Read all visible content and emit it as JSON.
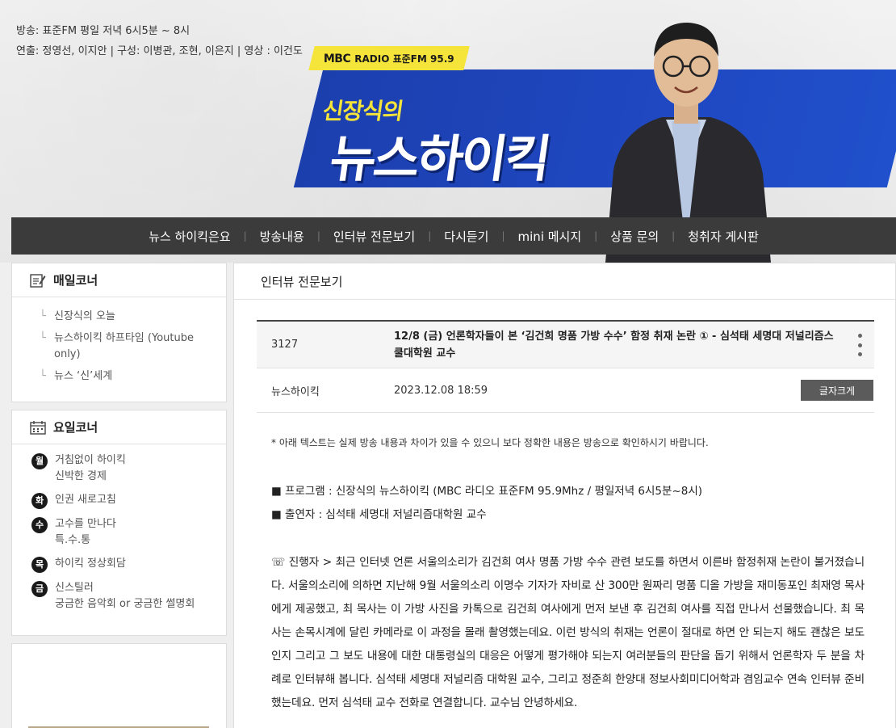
{
  "header": {
    "broadcast": "방송: 표준FM 평일 저녁 6시5분 ~ 8시",
    "staff": "연출: 정영선, 이지안 | 구성: 이병관, 조현, 이은지 | 영상 : 이건도",
    "logo_mbc": "MBC",
    "logo_radio": "RADIO 표준FM 95.9",
    "show_small": "신장식의",
    "show_big": "뉴스하이킥"
  },
  "nav": {
    "items": [
      "뉴스 하이킥은요",
      "방송내용",
      "인터뷰 전문보기",
      "다시듣기",
      "mini 메시지",
      "상품 문의",
      "청취자 게시판"
    ]
  },
  "sidebar": {
    "daily": {
      "title": "매일코너",
      "items": [
        "신장식의 오늘",
        "뉴스하이킥 하프타임 (Youtube only)",
        "뉴스 ‘신’세계"
      ]
    },
    "weekly": {
      "title": "요일코너",
      "items": [
        {
          "day": "월",
          "lines": [
            "거침없이 하이킥",
            "신박한 경제"
          ]
        },
        {
          "day": "화",
          "lines": [
            "인권 새로고침"
          ]
        },
        {
          "day": "수",
          "lines": [
            "고수를 만나다",
            "특.수.통"
          ]
        },
        {
          "day": "목",
          "lines": [
            "하이킥 정상회담"
          ]
        },
        {
          "day": "금",
          "lines": [
            "신스틸러",
            "궁금한 음악회 or 궁금한 썰명회"
          ]
        }
      ]
    }
  },
  "main": {
    "title": "인터뷰 전문보기",
    "post": {
      "number": "3127",
      "title": "12/8 (금) 언론학자들이 본 ‘김건희 명품 가방 수수’ 함정 취재 논란 ① - 심석태 세명대 저널리즘스쿨대학원 교수",
      "author": "뉴스하이킥",
      "date": "2023.12.08 18:59",
      "font_button": "글자크게"
    },
    "notice": "* 아래 텍스트는 실제 방송 내용과 차이가 있을 수 있으니 보다 정확한 내용은 방송으로 확인하시기 바랍니다.",
    "program": "■ 프로그램 : 신장식의 뉴스하이킥 (MBC 라디오 표준FM 95.9Mhz / 평일저녁 6시5분~8시)",
    "guest": "■ 출연자 : 심석태 세명대 저널리즘대학원 교수",
    "paragraph": "☏ 진행자 > 최근 인터넷 언론 서울의소리가 김건희 여사 명품 가방 수수 관련 보도를 하면서 이른바 함정취재 논란이 불거졌습니다. 서울의소리에 의하면 지난해 9월 서울의소리 이명수 기자가 자비로 산 300만 원짜리 명품 디올 가방을 재미동포인 최재영 목사에게 제공했고, 최 목사는 이 가방 사진을 카톡으로 김건희 여사에게 먼저 보낸 후 김건희 여사를 직접 만나서 선물했습니다. 최 목사는 손목시계에 달린 카메라로 이 과정을 몰래 촬영했는데요. 이런 방식의 취재는 언론이 절대로 하면 안 되는지 해도 괜찮은 보도인지 그리고 그 보도 내용에 대한 대통령실의 대응은 어떻게 평가해야 되는지 여러분들의 판단을 돕기 위해서 언론학자 두 분을 차례로 인터뷰해 봅니다. 심석태 세명대 저널리즘 대학원 교수, 그리고 정준희 한양대 정보사회미디어학과 겸임교수 연속 인터뷰 준비했는데요. 먼저 심석태 교수 전화로 연결합니다. 교수님 안녕하세요."
  },
  "colors": {
    "banner_blue": "#1f48c2",
    "banner_yellow": "#f5e43a",
    "nav_bg": "#3b3b3b"
  }
}
